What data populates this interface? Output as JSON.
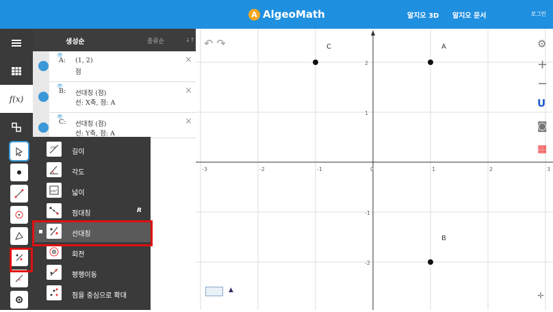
{
  "topbar": {
    "brand": "AlgeoMath",
    "link_3d": "알지오 3D",
    "link_docs": "알지오 문서",
    "login": "로그인"
  },
  "algebra": {
    "sort_by_creation": "생성순",
    "sort_by_type": "종류순",
    "sort_icon": "↓↑",
    "objects": [
      {
        "name": "A:",
        "line1": "(1, 2)",
        "line2": "점"
      },
      {
        "name": "B:",
        "line1": "선대칭 (점)",
        "line2": "선: X축, 점: A"
      },
      {
        "name": "C:",
        "line1": "선대칭 (점)",
        "line2": "선: Y축, 점: A"
      }
    ]
  },
  "sidebar": {
    "fx_label": "f(x)"
  },
  "transform_menu": {
    "items": [
      {
        "label": "길이",
        "shortcut": ""
      },
      {
        "label": "각도",
        "shortcut": ""
      },
      {
        "label": "넓이",
        "shortcut": ""
      },
      {
        "label": "점대칭",
        "shortcut": "R"
      },
      {
        "label": "선대칭",
        "shortcut": ""
      },
      {
        "label": "회전",
        "shortcut": ""
      },
      {
        "label": "평행이동",
        "shortcut": ""
      },
      {
        "label": "점을 중심으로 확대",
        "shortcut": ""
      }
    ],
    "selected": "선대칭"
  },
  "graph": {
    "x_ticks": [
      "-3",
      "-2",
      "-1",
      "0",
      "1",
      "2",
      "3"
    ],
    "y_ticks": [
      "2",
      "1",
      "-1",
      "-2"
    ],
    "points": [
      {
        "label": "A",
        "x": 1,
        "y": 2
      },
      {
        "label": "B",
        "x": 1,
        "y": -2
      },
      {
        "label": "C",
        "x": -1,
        "y": 2
      }
    ]
  },
  "colors": {
    "topbar": "#1f8fe0",
    "accent": "#3a98d8",
    "highlight": "#e01010"
  }
}
